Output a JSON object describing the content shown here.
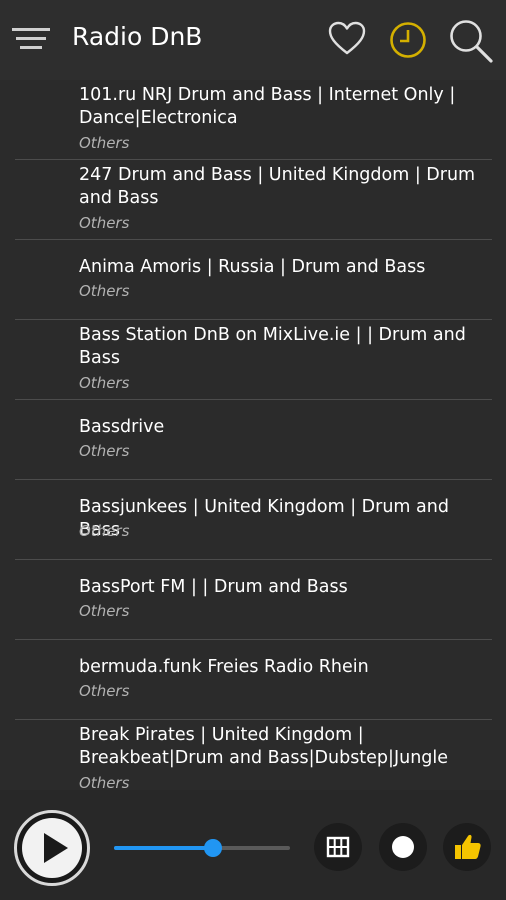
{
  "header": {
    "title": "Radio DnB",
    "accent_color": "#d4b000",
    "icons": [
      "menu-icon",
      "heart-icon",
      "clock-icon",
      "search-icon"
    ]
  },
  "stations": [
    {
      "title": "101.ru NRJ Drum and Bass | Internet Only | Dance|Electronica",
      "category": "Others"
    },
    {
      "title": "247 Drum and Bass | United Kingdom | Drum and Bass",
      "category": "Others"
    },
    {
      "title": "Anima Amoris | Russia | Drum and Bass",
      "category": "Others"
    },
    {
      "title": "Bass Station DnB on MixLive.ie | | Drum and Bass",
      "category": "Others"
    },
    {
      "title": "Bassdrive",
      "category": "Others"
    },
    {
      "title": "Bassjunkees | United Kingdom | Drum and Bass",
      "category": "Others"
    },
    {
      "title": "BassPort FM | | Drum and Bass",
      "category": "Others"
    },
    {
      "title": "bermuda.funk Freies Radio Rhein",
      "category": "Others"
    },
    {
      "title": "Break Pirates | United Kingdom | Breakbeat|Drum and Bass|Dubstep|Jungle",
      "category": "Others"
    }
  ],
  "player": {
    "volume_fraction": 0.56,
    "slider_color": "#2196f3",
    "like_color": "#f5c400",
    "icons": [
      "play-icon",
      "grid-icon",
      "record-icon",
      "thumbs-up-icon"
    ]
  }
}
